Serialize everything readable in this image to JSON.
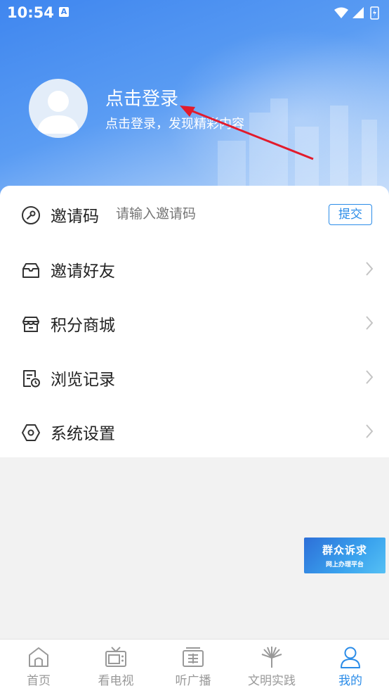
{
  "status_bar": {
    "time": "10:54",
    "app_badge": "A"
  },
  "profile": {
    "title": "点击登录",
    "subtitle": "点击登录，发现精彩内容"
  },
  "invite_code": {
    "label": "邀请码",
    "placeholder": "请输入邀请码",
    "submit_label": "提交"
  },
  "menu": [
    {
      "label": "邀请好友",
      "icon": "mail-open-icon"
    },
    {
      "label": "积分商城",
      "icon": "store-icon"
    },
    {
      "label": "浏览记录",
      "icon": "history-doc-icon"
    },
    {
      "label": "系统设置",
      "icon": "settings-hexagon-icon"
    }
  ],
  "banner": {
    "title": "群众诉求",
    "subtitle": "网上办理平台"
  },
  "tabbar": [
    {
      "label": "首页",
      "icon": "home-icon",
      "active": false
    },
    {
      "label": "看电视",
      "icon": "tv-icon",
      "active": false
    },
    {
      "label": "听广播",
      "icon": "radio-icon",
      "active": false
    },
    {
      "label": "文明实践",
      "icon": "civilization-icon",
      "active": false
    },
    {
      "label": "我的",
      "icon": "user-icon",
      "active": true
    }
  ],
  "colors": {
    "header_blue": "#3f86ef",
    "accent": "#2b8ce8",
    "annotation_arrow": "#e21b2c"
  }
}
